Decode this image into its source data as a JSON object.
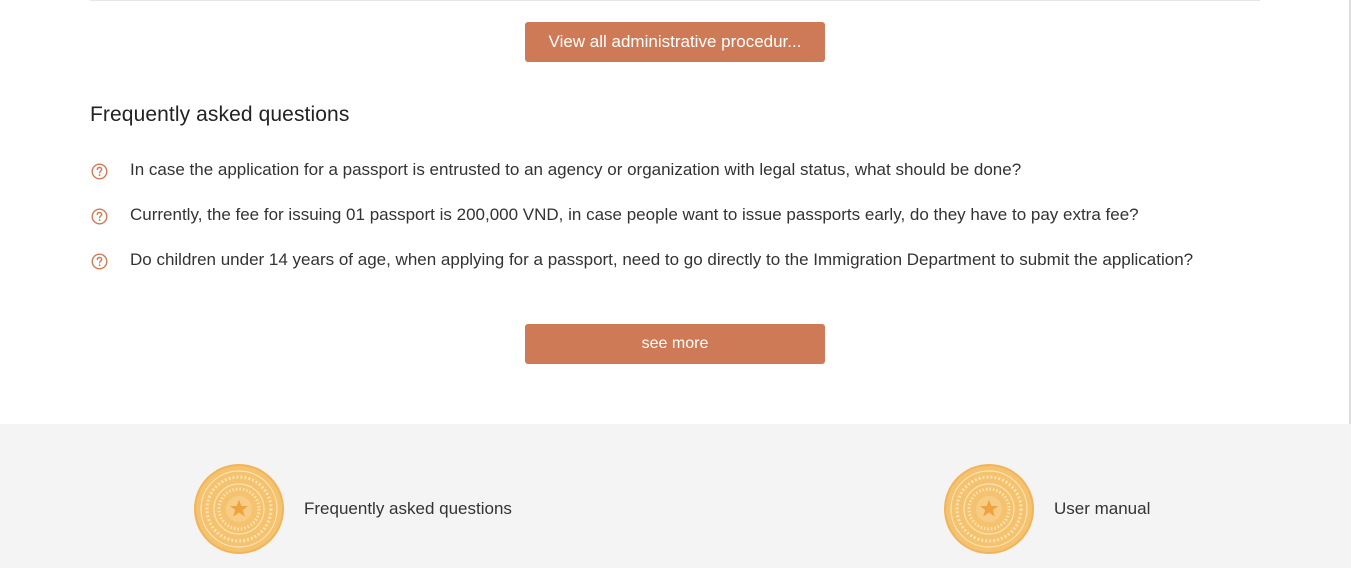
{
  "procedures": {
    "view_all_label": "View all administrative procedur..."
  },
  "faq": {
    "title": "Frequently asked questions",
    "icon": "question-circle-icon",
    "items": [
      {
        "text": "In case the application for a passport is entrusted to an agency or organization with legal status, what should be done?"
      },
      {
        "text": "Currently, the fee for issuing 01 passport is 200,000 VND, in case people want to issue passports early, do they have to pay extra fee?"
      },
      {
        "text": "Do children under 14 years of age, when applying for a passport, need to go directly to the Immigration Department to submit the application?"
      }
    ],
    "see_more_label": "see more"
  },
  "quick_links": [
    {
      "label": "Frequently asked questions",
      "icon": "national-emblem-icon"
    },
    {
      "label": "User manual",
      "icon": "national-emblem-icon"
    }
  ],
  "colors": {
    "accent": "#cf7a57",
    "footer_bg": "#f4f4f4",
    "emblem_gold": "#f2b45a"
  }
}
